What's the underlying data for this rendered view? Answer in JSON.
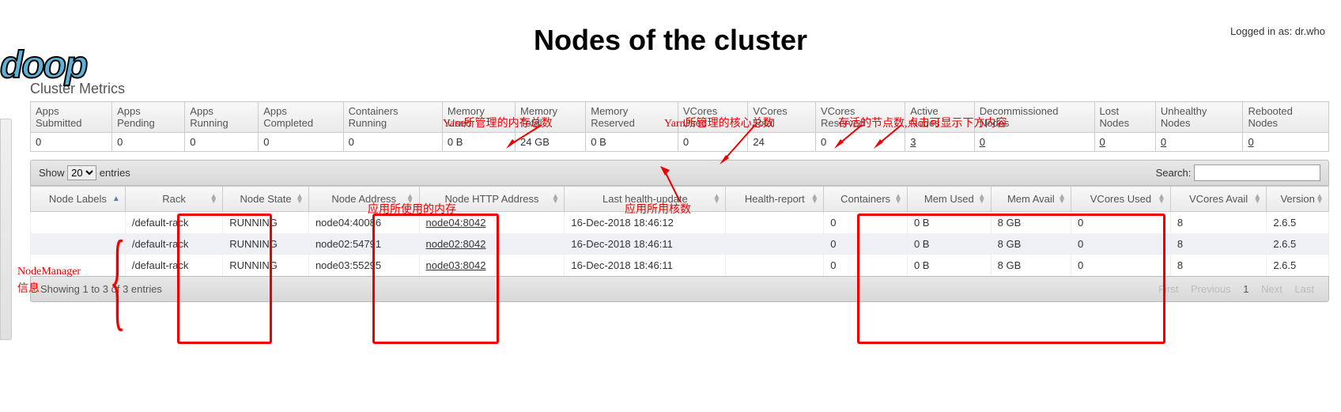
{
  "login_text": "Logged in as: dr.who",
  "logo_text": "doop",
  "page_title": "Nodes of the cluster",
  "section_title": "Cluster Metrics",
  "metrics": {
    "headers": [
      "Apps Submitted",
      "Apps Pending",
      "Apps Running",
      "Apps Completed",
      "Containers Running",
      "Memory Used",
      "Memory Total",
      "Memory Reserved",
      "VCores Used",
      "VCores Total",
      "VCores Reserved",
      "Active Nodes",
      "Decommissioned Nodes",
      "Lost Nodes",
      "Unhealthy Nodes",
      "Rebooted Nodes"
    ],
    "values": [
      "0",
      "0",
      "0",
      "0",
      "0",
      "0 B",
      "24 GB",
      "0 B",
      "0",
      "24",
      "0",
      "3",
      "0",
      "0",
      "0",
      "0"
    ]
  },
  "controls": {
    "show_label": "Show",
    "show_value": "20",
    "entries_label": "entries",
    "search_label": "Search:",
    "search_value": ""
  },
  "nodes": {
    "headers": [
      "Node Labels",
      "Rack",
      "Node State",
      "Node Address",
      "Node HTTP Address",
      "Last health-update",
      "Health-report",
      "Containers",
      "Mem Used",
      "Mem Avail",
      "VCores Used",
      "VCores Avail",
      "Version"
    ],
    "rows": [
      {
        "labels": "",
        "rack": "/default-rack",
        "state": "RUNNING",
        "addr": "node04:40086",
        "http": "node04:8042",
        "health": "16-Dec-2018 18:46:12",
        "report": "",
        "containers": "0",
        "memused": "0 B",
        "memavail": "8 GB",
        "vcused": "0",
        "vcavail": "8",
        "version": "2.6.5"
      },
      {
        "labels": "",
        "rack": "/default-rack",
        "state": "RUNNING",
        "addr": "node02:54791",
        "http": "node02:8042",
        "health": "16-Dec-2018 18:46:11",
        "report": "",
        "containers": "0",
        "memused": "0 B",
        "memavail": "8 GB",
        "vcused": "0",
        "vcavail": "8",
        "version": "2.6.5"
      },
      {
        "labels": "",
        "rack": "/default-rack",
        "state": "RUNNING",
        "addr": "node03:55295",
        "http": "node03:8042",
        "health": "16-Dec-2018 18:46:11",
        "report": "",
        "containers": "0",
        "memused": "0 B",
        "memavail": "8 GB",
        "vcused": "0",
        "vcavail": "8",
        "version": "2.6.5"
      }
    ]
  },
  "footer": {
    "info": "Showing 1 to 3 of 3 entries",
    "pages": [
      "First",
      "Previous",
      "1",
      "Next",
      "Last"
    ]
  },
  "annotations": {
    "a1": "Yarn所管理的内存总数",
    "a2": "Yarn所管理的核心总数",
    "a3": "存活的节点数,点击可显示下方内容",
    "a4": "应用所使用的内存",
    "a5": "应用所用核数",
    "a6": "NodeManager",
    "a7": "信息"
  }
}
